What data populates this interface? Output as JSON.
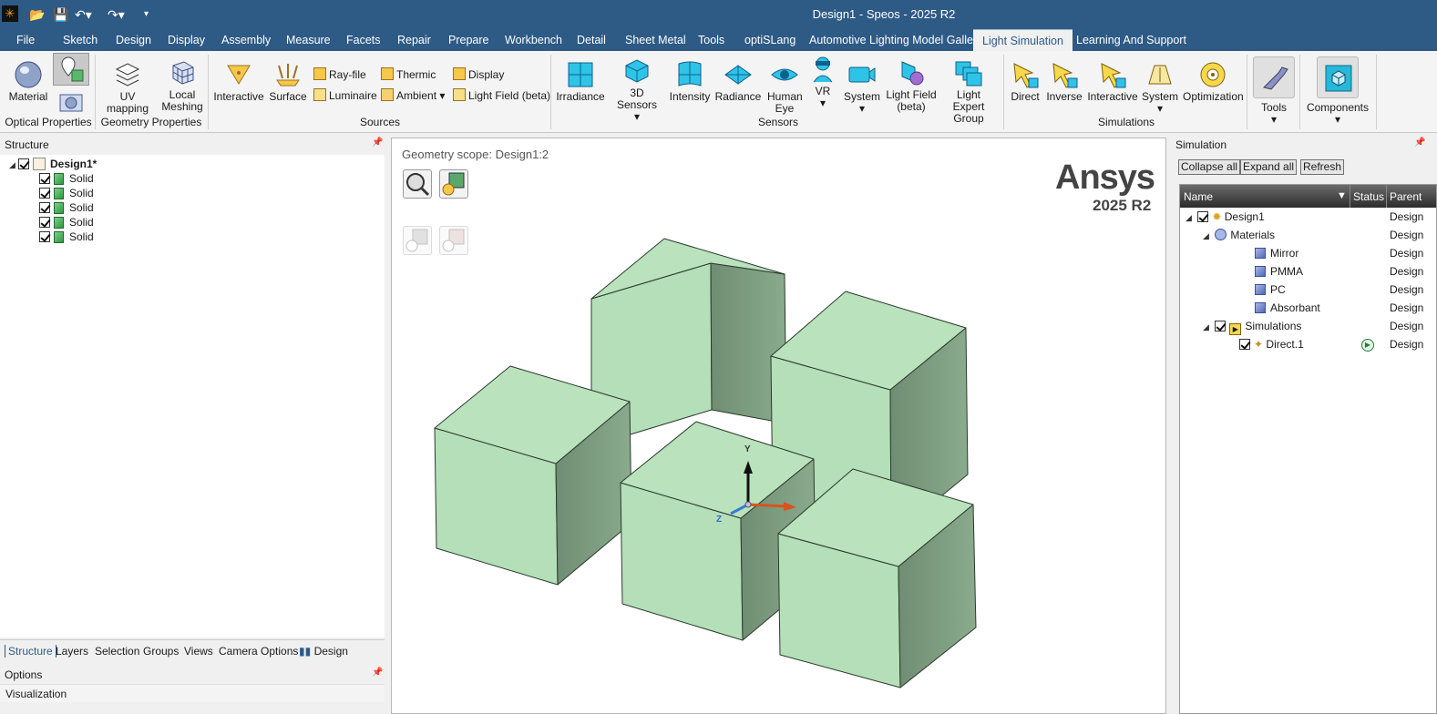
{
  "window": {
    "title": "Design1 - Speos - 2025 R2"
  },
  "menu": {
    "tabs": [
      "File",
      "Sketch",
      "Design",
      "Display",
      "Assembly",
      "Measure",
      "Facets",
      "Repair",
      "Prepare",
      "Workbench",
      "Detail",
      "Sheet Metal",
      "Tools",
      "optiSLang",
      "Automotive Lighting Model Gallery",
      "Light Simulation",
      "Learning And Support"
    ],
    "active": "Light Simulation"
  },
  "ribbon": {
    "optical": {
      "material": "Material",
      "group": "Optical Properties"
    },
    "geometry": {
      "uv": "UV mapping",
      "local": "Local Meshing",
      "group": "Geometry Properties"
    },
    "sources": {
      "interactive": "Interactive",
      "surface": "Surface",
      "rayfile": "Ray-file",
      "luminaire": "Luminaire",
      "thermic": "Thermic",
      "ambient": "Ambient",
      "display": "Display",
      "lightfield": "Light Field (beta)",
      "group": "Sources"
    },
    "sensors": {
      "irradiance": "Irradiance",
      "sensors3d": "3D Sensors",
      "intensity": "Intensity",
      "radiance": "Radiance",
      "humaneye": "Human Eye",
      "vr": "VR",
      "system": "System",
      "lightfield": "Light Field (beta)",
      "expert": "Light Expert Group",
      "group": "Sensors"
    },
    "simulations": {
      "direct": "Direct",
      "inverse": "Inverse",
      "interactive": "Interactive",
      "system": "System",
      "optimization": "Optimization",
      "group": "Simulations"
    },
    "tools": "Tools",
    "components": "Components"
  },
  "structure": {
    "title": "Structure",
    "root": "Design1*",
    "children": [
      "Solid",
      "Solid",
      "Solid",
      "Solid",
      "Solid"
    ],
    "tabs": [
      "Structure",
      "Layers",
      "Selection",
      "Groups",
      "Views",
      "Camera Options",
      "Design"
    ],
    "options": "Options",
    "visualization": "Visualization"
  },
  "viewport": {
    "scope": "Geometry scope: Design1:2",
    "brand": "Ansys",
    "version": "2025 R2",
    "axes": {
      "y": "Y",
      "z": "Z"
    }
  },
  "simulation": {
    "title": "Simulation",
    "buttons": {
      "collapse": "Collapse all",
      "expand": "Expand all",
      "refresh": "Refresh"
    },
    "columns": {
      "name": "Name",
      "status": "Status",
      "parent": "Parent"
    },
    "rows": [
      {
        "label": "Design1",
        "parent": "Design"
      },
      {
        "label": "Materials",
        "parent": "Design"
      },
      {
        "label": "Mirror",
        "parent": "Design"
      },
      {
        "label": "PMMA",
        "parent": "Design"
      },
      {
        "label": "PC",
        "parent": "Design"
      },
      {
        "label": "Absorbant",
        "parent": "Design"
      },
      {
        "label": "Simulations",
        "parent": "Design"
      },
      {
        "label": "Direct.1",
        "parent": "Design"
      }
    ]
  },
  "colors": {
    "titlebar": "#2e5a86",
    "cube_top": "#b9e2bd",
    "cube_left": "#b4dfb8",
    "cube_right": "#7b9a7e"
  }
}
